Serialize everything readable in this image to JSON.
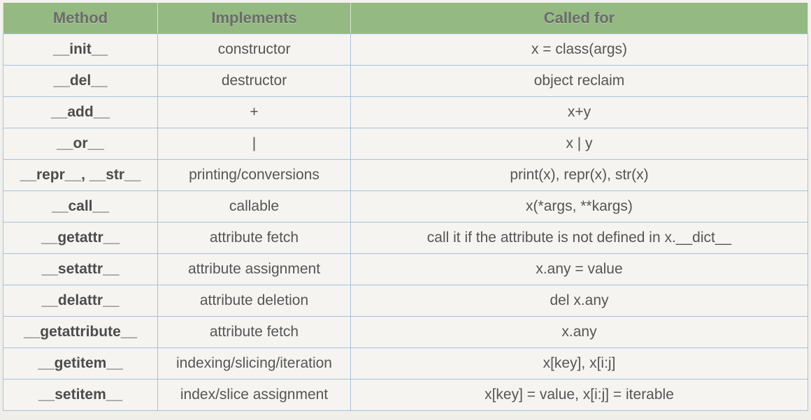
{
  "table": {
    "headers": [
      "Method",
      "Implements",
      "Called for"
    ],
    "rows": [
      {
        "method": "__init__",
        "implements": "constructor",
        "called_for": "x = class(args)"
      },
      {
        "method": "__del__",
        "implements": "destructor",
        "called_for": "object reclaim"
      },
      {
        "method": "__add__",
        "implements": "+",
        "called_for": "x+y"
      },
      {
        "method": "__or__",
        "implements": "|",
        "called_for": "x | y"
      },
      {
        "method": "__repr__, __str__",
        "implements": "printing/conversions",
        "called_for": "print(x), repr(x), str(x)"
      },
      {
        "method": "__call__",
        "implements": "callable",
        "called_for": "x(*args, **kargs)"
      },
      {
        "method": "__getattr__",
        "implements": "attribute fetch",
        "called_for": "call it if the attribute is not defined in x.__dict__"
      },
      {
        "method": "__setattr__",
        "implements": "attribute assignment",
        "called_for": "x.any = value"
      },
      {
        "method": "__delattr__",
        "implements": "attribute deletion",
        "called_for": "del x.any"
      },
      {
        "method": "__getattribute__",
        "implements": "attribute fetch",
        "called_for": "x.any"
      },
      {
        "method": "__getitem__",
        "implements": "indexing/slicing/iteration",
        "called_for": "x[key], x[i:j]"
      },
      {
        "method": "__setitem__",
        "implements": "index/slice assignment",
        "called_for": "x[key] = value, x[i:j] = iterable"
      }
    ]
  },
  "colors": {
    "header_background": "#94b983",
    "header_text": "#6b6b6b",
    "grid_lines": "#a9c1dc",
    "cell_text": "#555555"
  }
}
